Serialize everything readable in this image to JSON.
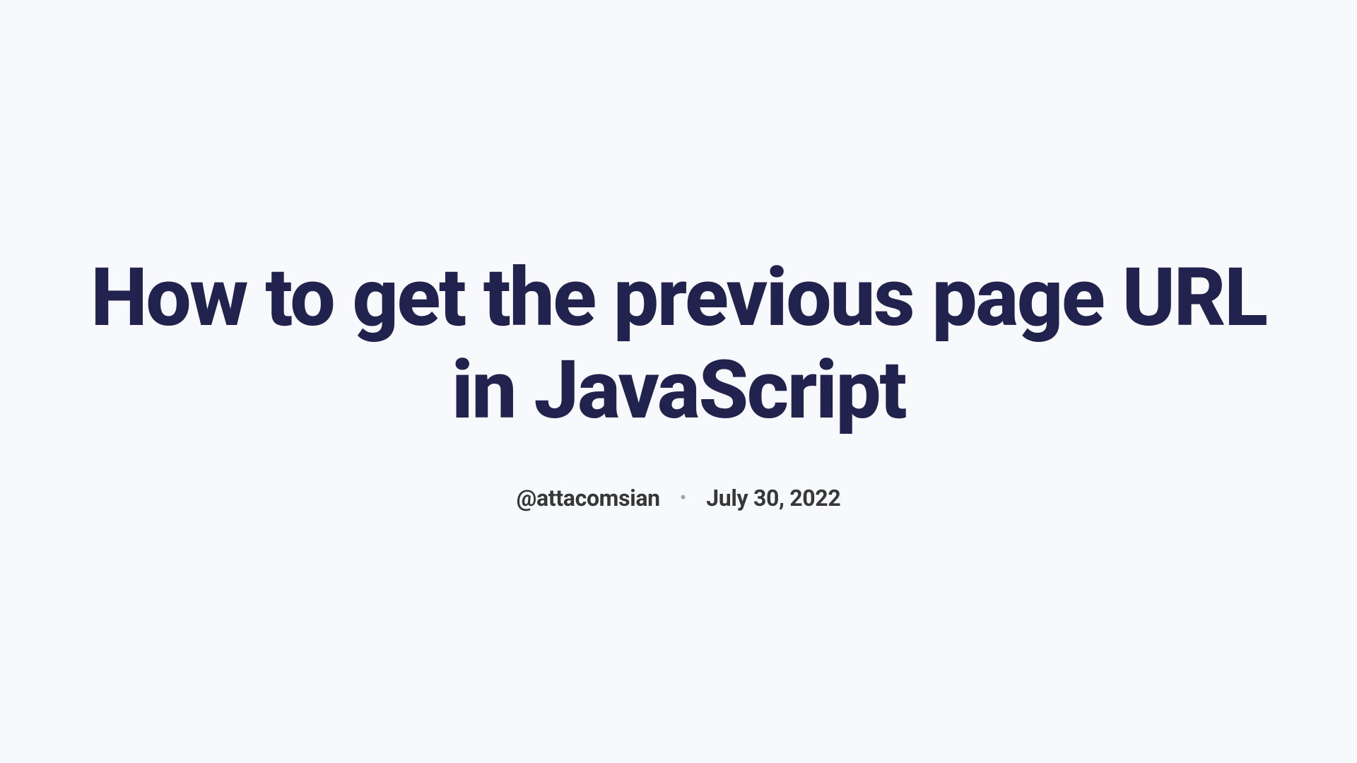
{
  "article": {
    "title": "How to get the previous page URL in JavaScript",
    "author": "@attacomsian",
    "separator": "•",
    "date": "July 30, 2022"
  }
}
